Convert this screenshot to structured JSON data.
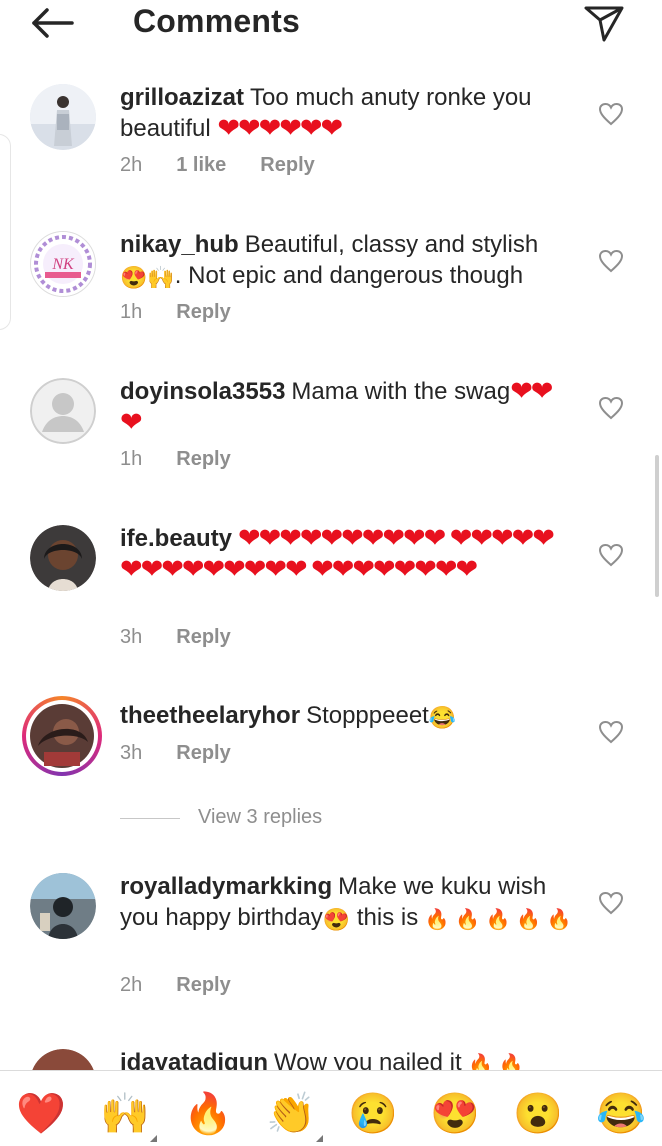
{
  "header": {
    "title": "Comments"
  },
  "comments": [
    {
      "username": "grilloazizat",
      "text": "Too much anuty ronke you beautiful",
      "time": "2h",
      "likes": "1 like",
      "reply": "Reply"
    },
    {
      "username": "nikay_hub",
      "text": "Beautiful, classy and stylish",
      "text2": ". Not epic and dangerous though",
      "time": "1h",
      "reply": "Reply"
    },
    {
      "username": "doyinsola3553",
      "text": "Mama with the swag",
      "time": "1h",
      "reply": "Reply"
    },
    {
      "username": "ife.beauty",
      "time": "3h",
      "reply": "Reply"
    },
    {
      "username": "theetheelaryhor",
      "text": "Stopppeeet",
      "time": "3h",
      "reply": "Reply"
    },
    {
      "username": "royalladymarkking",
      "text": "Make we kuku wish you happy birthday",
      "text2": " this is ",
      "time": "2h",
      "reply": "Reply"
    },
    {
      "username": "idayatadigun",
      "text": "Wow you nailed it"
    }
  ],
  "view_replies": "View 3 replies",
  "reactions": [
    "❤️",
    "🙌",
    "🔥",
    "👏",
    "😢",
    "😍",
    "😮",
    "😂"
  ],
  "colors": {
    "accent_heart": "#e8101e",
    "meta_gray": "#8e8e8e",
    "story_ring": "#e1306c"
  }
}
